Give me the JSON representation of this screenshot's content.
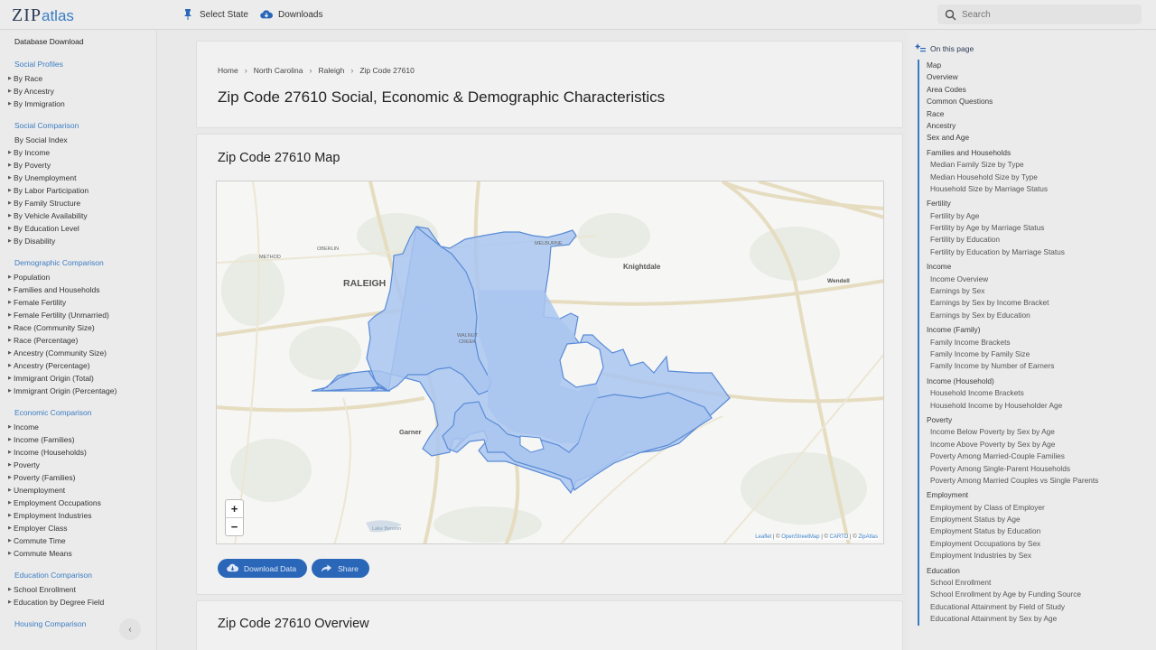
{
  "brand": {
    "zip": "ZIP",
    "atlas": "atlas"
  },
  "topnav": {
    "select_state": "Select State",
    "downloads": "Downloads",
    "search_placeholder": "Search"
  },
  "leftnav": {
    "database_download": "Database Download",
    "groups": [
      {
        "heading": "Social Profiles",
        "items": [
          {
            "label": "By Race",
            "arrow": true
          },
          {
            "label": "By Ancestry",
            "arrow": true
          },
          {
            "label": "By Immigration",
            "arrow": true
          }
        ]
      },
      {
        "heading": "Social Comparison",
        "items": [
          {
            "label": "By Social Index",
            "arrow": false
          },
          {
            "label": "By Income",
            "arrow": true
          },
          {
            "label": "By Poverty",
            "arrow": true
          },
          {
            "label": "By Unemployment",
            "arrow": true
          },
          {
            "label": "By Labor Participation",
            "arrow": true
          },
          {
            "label": "By Family Structure",
            "arrow": true
          },
          {
            "label": "By Vehicle Availability",
            "arrow": true
          },
          {
            "label": "By Education Level",
            "arrow": true
          },
          {
            "label": "By Disability",
            "arrow": true
          }
        ]
      },
      {
        "heading": "Demographic Comparison",
        "items": [
          {
            "label": "Population",
            "arrow": true
          },
          {
            "label": "Families and Households",
            "arrow": true
          },
          {
            "label": "Female Fertility",
            "arrow": true
          },
          {
            "label": "Female Fertility (Unmarried)",
            "arrow": true
          },
          {
            "label": "Race (Community Size)",
            "arrow": true
          },
          {
            "label": "Race (Percentage)",
            "arrow": true
          },
          {
            "label": "Ancestry (Community Size)",
            "arrow": true
          },
          {
            "label": "Ancestry (Percentage)",
            "arrow": true
          },
          {
            "label": "Immigrant Origin (Total)",
            "arrow": true
          },
          {
            "label": "Immigrant Origin (Percentage)",
            "arrow": true
          }
        ]
      },
      {
        "heading": "Economic Comparison",
        "items": [
          {
            "label": "Income",
            "arrow": true
          },
          {
            "label": "Income (Families)",
            "arrow": true
          },
          {
            "label": "Income (Households)",
            "arrow": true
          },
          {
            "label": "Poverty",
            "arrow": true
          },
          {
            "label": "Poverty (Families)",
            "arrow": true
          },
          {
            "label": "Unemployment",
            "arrow": true
          },
          {
            "label": "Employment Occupations",
            "arrow": true
          },
          {
            "label": "Employment Industries",
            "arrow": true
          },
          {
            "label": "Employer Class",
            "arrow": true
          },
          {
            "label": "Commute Time",
            "arrow": true
          },
          {
            "label": "Commute Means",
            "arrow": true
          }
        ]
      },
      {
        "heading": "Education Comparison",
        "items": [
          {
            "label": "School Enrollment",
            "arrow": true
          },
          {
            "label": "Education by Degree Field",
            "arrow": true
          }
        ]
      },
      {
        "heading": "Housing Comparison",
        "items": []
      }
    ]
  },
  "breadcrumb": [
    "Home",
    "North Carolina",
    "Raleigh",
    "Zip Code 27610"
  ],
  "page_title": "Zip Code 27610 Social, Economic & Demographic Characteristics",
  "map_section": {
    "title": "Zip Code 27610 Map",
    "labels": {
      "raleigh": "RALEIGH",
      "knightdale": "Knightdale",
      "wendell": "Wendell",
      "garner": "Garner",
      "oberlin": "OBERLIN",
      "method": "METHOD",
      "melburne": "MELBURNE",
      "walnut_creek_1": "WALNUT",
      "walnut_creek_2": "CREEK",
      "lake_benson": "Lake Benson"
    },
    "zoom_in": "+",
    "zoom_out": "−",
    "attribution": {
      "leaflet": "Leaflet",
      "sep1": " | © ",
      "osm": "OpenStreetMap",
      "sep2": " | © ",
      "carto": "CARTO",
      "sep3": " | © ",
      "zipatlas": "ZipAtlas"
    },
    "download_label": "Download Data",
    "share_label": "Share",
    "accent_color": "#2b67b8",
    "region_fill": "#a9c6f0",
    "region_stroke": "#5a8bd6"
  },
  "overview_title": "Zip Code 27610 Overview",
  "toc": {
    "heading": "On this page",
    "items": [
      {
        "label": "Map",
        "sub": false,
        "sec": false
      },
      {
        "label": "Overview",
        "sub": false,
        "sec": false
      },
      {
        "label": "Area Codes",
        "sub": false,
        "sec": false
      },
      {
        "label": "Common Questions",
        "sub": false,
        "sec": false
      },
      {
        "label": "Race",
        "sub": false,
        "sec": false
      },
      {
        "label": "Ancestry",
        "sub": false,
        "sec": false
      },
      {
        "label": "Sex and Age",
        "sub": false,
        "sec": false
      },
      {
        "label": "Families and Households",
        "sub": false,
        "sec": true
      },
      {
        "label": "Median Family Size by Type",
        "sub": true,
        "sec": false
      },
      {
        "label": "Median Household Size by Type",
        "sub": true,
        "sec": false
      },
      {
        "label": "Household Size by Marriage Status",
        "sub": true,
        "sec": false
      },
      {
        "label": "Fertility",
        "sub": false,
        "sec": true
      },
      {
        "label": "Fertility by Age",
        "sub": true,
        "sec": false
      },
      {
        "label": "Fertility by Age by Marriage Status",
        "sub": true,
        "sec": false
      },
      {
        "label": "Fertility by Education",
        "sub": true,
        "sec": false
      },
      {
        "label": "Fertility by Education by Marriage Status",
        "sub": true,
        "sec": false
      },
      {
        "label": "Income",
        "sub": false,
        "sec": true
      },
      {
        "label": "Income Overview",
        "sub": true,
        "sec": false
      },
      {
        "label": "Earnings by Sex",
        "sub": true,
        "sec": false
      },
      {
        "label": "Earnings by Sex by Income Bracket",
        "sub": true,
        "sec": false
      },
      {
        "label": "Earnings by Sex by Education",
        "sub": true,
        "sec": false
      },
      {
        "label": "Income (Family)",
        "sub": false,
        "sec": true
      },
      {
        "label": "Family Income Brackets",
        "sub": true,
        "sec": false
      },
      {
        "label": "Family Income by Family Size",
        "sub": true,
        "sec": false
      },
      {
        "label": "Family Income by Number of Earners",
        "sub": true,
        "sec": false
      },
      {
        "label": "Income (Household)",
        "sub": false,
        "sec": true
      },
      {
        "label": "Household Income Brackets",
        "sub": true,
        "sec": false
      },
      {
        "label": "Household Income by Householder Age",
        "sub": true,
        "sec": false
      },
      {
        "label": "Poverty",
        "sub": false,
        "sec": true
      },
      {
        "label": "Income Below Poverty by Sex by Age",
        "sub": true,
        "sec": false
      },
      {
        "label": "Income Above Poverty by Sex by Age",
        "sub": true,
        "sec": false
      },
      {
        "label": "Poverty Among Married-Couple Families",
        "sub": true,
        "sec": false
      },
      {
        "label": "Poverty Among Single-Parent Households",
        "sub": true,
        "sec": false
      },
      {
        "label": "Poverty Among Married Couples vs Single Parents",
        "sub": true,
        "sec": false
      },
      {
        "label": "Employment",
        "sub": false,
        "sec": true
      },
      {
        "label": "Employment by Class of Employer",
        "sub": true,
        "sec": false
      },
      {
        "label": "Employment Status by Age",
        "sub": true,
        "sec": false
      },
      {
        "label": "Employment Status by Education",
        "sub": true,
        "sec": false
      },
      {
        "label": "Employment Occupations by Sex",
        "sub": true,
        "sec": false
      },
      {
        "label": "Employment Industries by Sex",
        "sub": true,
        "sec": false
      },
      {
        "label": "Education",
        "sub": false,
        "sec": true
      },
      {
        "label": "School Enrollment",
        "sub": true,
        "sec": false
      },
      {
        "label": "School Enrollment by Age by Funding Source",
        "sub": true,
        "sec": false
      },
      {
        "label": "Educational Attainment by Field of Study",
        "sub": true,
        "sec": false
      },
      {
        "label": "Educational Attainment by Sex by Age",
        "sub": true,
        "sec": false
      }
    ]
  }
}
